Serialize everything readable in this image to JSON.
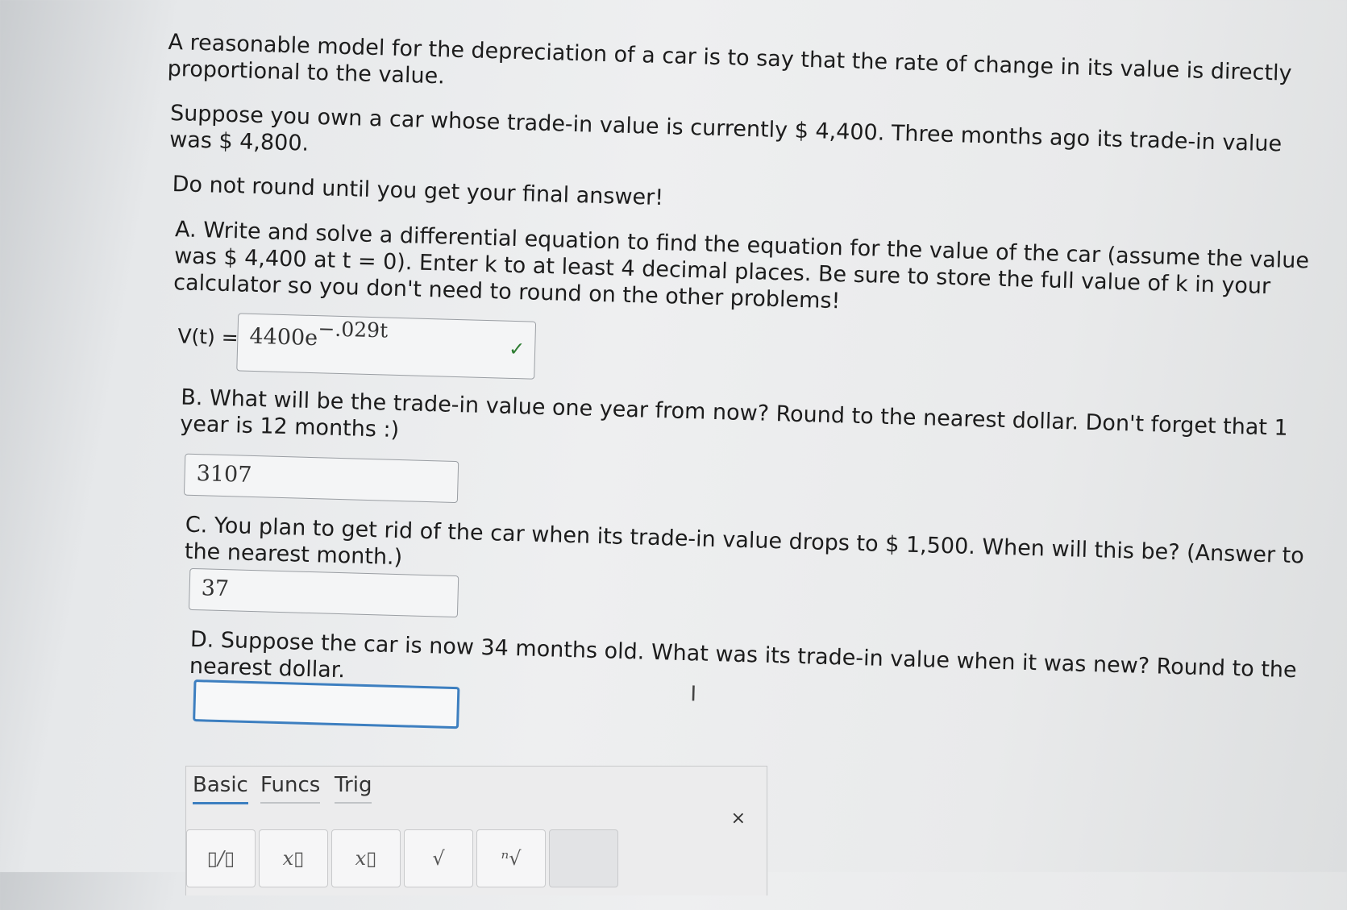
{
  "question": {
    "intro": "A reasonable model for the depreciation of a car is to say that the rate of change in its value is directly proportional to the value.",
    "setup": "Suppose you own a car whose trade-in value is currently $ 4,400. Three months ago its trade-in value was $ 4,800.",
    "note": "Do not round until you get your final answer!"
  },
  "part_a": {
    "text": "A. Write and solve a differential equation to find the equation for the value of the car (assume the value was $ 4,400 at t = 0). Enter k to at least 4 decimal places. Be sure to store the full value of k in your calculator so you don't need to round on the other problems!",
    "label": "V(t) =",
    "answer_base": "4400e",
    "answer_exponent": "−.029t",
    "status_icon": "checkmark-icon"
  },
  "part_b": {
    "text": "B. What will be the trade-in value one year from now? Round to the nearest dollar. Don't forget that 1 year is 12 months :)",
    "answer": "3107"
  },
  "part_c": {
    "text": "C. You plan to get rid of the car when its trade-in value drops to $ 1,500. When will this be? (Answer to the nearest month.)",
    "answer": "37"
  },
  "part_d": {
    "text": "D. Suppose the car is now 34 months old. What was its trade-in value when it was new? Round to the nearest dollar.",
    "answer": ""
  },
  "math_toolbar": {
    "tabs": [
      "Basic",
      "Funcs",
      "Trig"
    ],
    "active_tab": "Basic",
    "close_label": "×",
    "keys": [
      "▯/▯",
      "x▯",
      "x▯",
      "√",
      "ⁿ√"
    ]
  },
  "colors": {
    "accent": "#3d7fc0",
    "check": "#2e7d32"
  }
}
